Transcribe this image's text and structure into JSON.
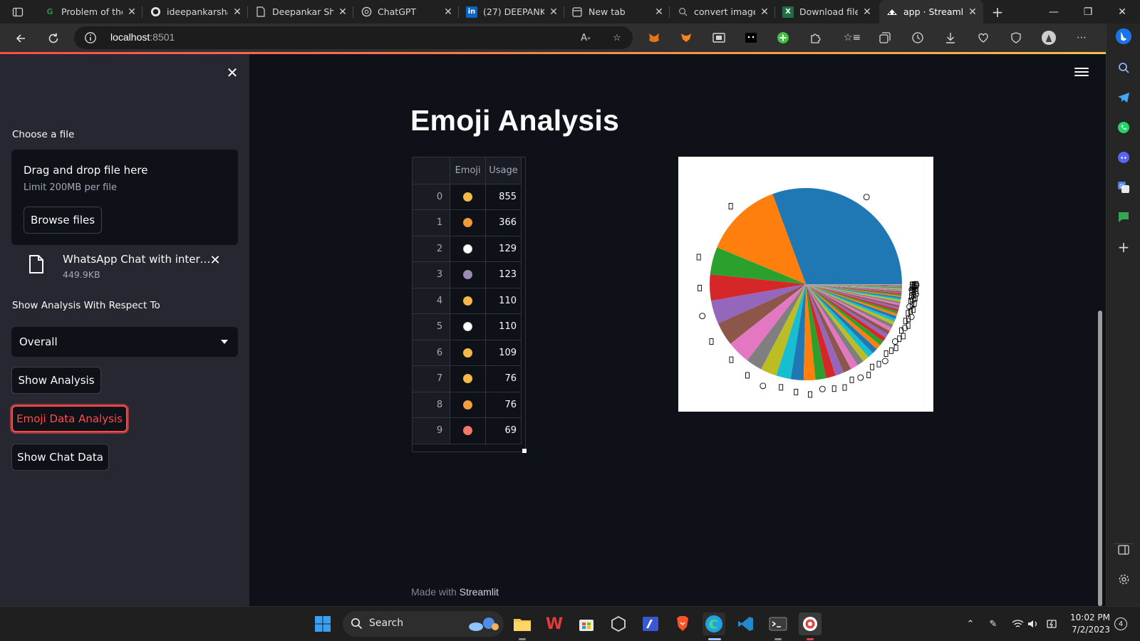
{
  "browser": {
    "tabs": [
      {
        "title": "Problem of the",
        "icon": "gfg-icon",
        "active": false
      },
      {
        "title": "ideepankarsha",
        "icon": "github-icon",
        "active": false
      },
      {
        "title": "Deepankar Sh",
        "icon": "document-icon",
        "active": false
      },
      {
        "title": "ChatGPT",
        "icon": "chatgpt-icon",
        "active": false
      },
      {
        "title": "(27) DEEPANK",
        "icon": "linkedin-icon",
        "active": false
      },
      {
        "title": "New tab",
        "icon": "newtab-icon",
        "active": false
      },
      {
        "title": "convert image",
        "icon": "search-icon",
        "active": false
      },
      {
        "title": "Download file",
        "icon": "excel-icon",
        "active": false
      },
      {
        "title": "app · Streamlit",
        "icon": "streamlit-icon",
        "active": true
      }
    ],
    "address": {
      "host": "localhost",
      "port": ":8501"
    }
  },
  "sidebar": {
    "uploader_label": "Choose a file",
    "drop_title": "Drag and drop file here",
    "drop_limit": "Limit 200MB per file",
    "browse_label": "Browse files",
    "file_name": "WhatsApp Chat with intern...",
    "file_size": "449.9KB",
    "select_label": "Show Analysis With Respect To",
    "select_value": "Overall",
    "btn_show_analysis": "Show Analysis",
    "btn_emoji": "Emoji Data Analysis",
    "btn_chat": "Show Chat Data"
  },
  "main": {
    "title": "Emoji Analysis",
    "table": {
      "headers": [
        "",
        "Emoji",
        "Usage"
      ],
      "rows": [
        {
          "index": "0",
          "emoji_color": "#f5b94a",
          "usage": "855"
        },
        {
          "index": "1",
          "emoji_color": "#f09a3a",
          "usage": "366"
        },
        {
          "index": "2",
          "emoji_color": "#ffffff",
          "usage": "129"
        },
        {
          "index": "3",
          "emoji_color": "#9a8db5",
          "usage": "123"
        },
        {
          "index": "4",
          "emoji_color": "#f5b94a",
          "usage": "110"
        },
        {
          "index": "5",
          "emoji_color": "#ffffff",
          "usage": "110"
        },
        {
          "index": "6",
          "emoji_color": "#f5b94a",
          "usage": "109"
        },
        {
          "index": "7",
          "emoji_color": "#f5b94a",
          "usage": "76"
        },
        {
          "index": "8",
          "emoji_color": "#f0a040",
          "usage": "76"
        },
        {
          "index": "9",
          "emoji_color": "#f07a6a",
          "usage": "69"
        }
      ]
    },
    "footer_prefix": "Made with",
    "footer_brand": "Streamlit"
  },
  "chart_data": {
    "type": "pie",
    "values": [
      855,
      366,
      129,
      123,
      110,
      110,
      109,
      76,
      76,
      69,
      60,
      55,
      50,
      45,
      40,
      38,
      35,
      32,
      30,
      28,
      26,
      24,
      22,
      20,
      19,
      18,
      17,
      16,
      15,
      14,
      13,
      12,
      11,
      10,
      10,
      9,
      9,
      8,
      8,
      7,
      7,
      6,
      6,
      5,
      5,
      5,
      4,
      4,
      4,
      3,
      3,
      3,
      2,
      2,
      2,
      2,
      1,
      1,
      1,
      1
    ],
    "colors": [
      "#1f77b4",
      "#ff7f0e",
      "#2ca02c",
      "#d62728",
      "#9467bd",
      "#8c564b",
      "#e377c2",
      "#7f7f7f",
      "#bcbd22",
      "#17becf"
    ],
    "start_angle_deg": 0,
    "counterclock": true,
    "labels_note": "emoji glyph labels (rendered as boxes)"
  },
  "taskbar": {
    "search_label": "Search",
    "time": "10:02 PM",
    "date": "7/2/2023",
    "notifications": "4"
  }
}
